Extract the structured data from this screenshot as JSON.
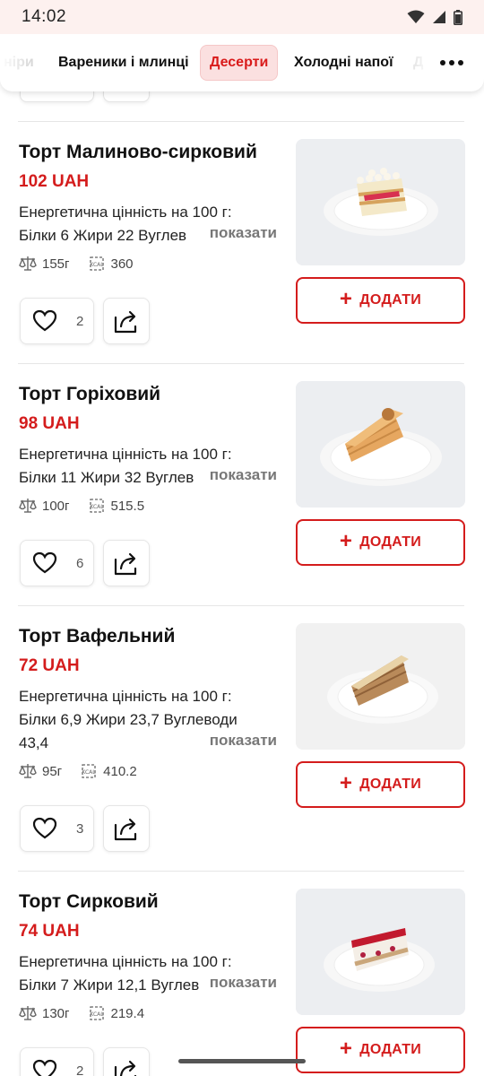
{
  "status_bar": {
    "time": "14:02"
  },
  "tabs": [
    {
      "label": "ніри",
      "state": "faded"
    },
    {
      "label": "Вареники і млинці",
      "state": "normal"
    },
    {
      "label": "Десерти",
      "state": "active"
    },
    {
      "label": "Холодні напої",
      "state": "normal"
    },
    {
      "label": "Д",
      "state": "faded"
    }
  ],
  "products": [
    {
      "name": "Торт Малиново-сирковий",
      "price": "102 UAH",
      "nutrition_line1": "Енергетична цінність на 100 г:",
      "nutrition_line2": "Білки 6 Жири 22 Вуглев",
      "nutrition_line3": "",
      "show_more": "показати",
      "weight": "155г",
      "kcal": "360",
      "likes": "2",
      "add_label": "ДОДАТИ"
    },
    {
      "name": "Торт Горіховий",
      "price": "98 UAH",
      "nutrition_line1": "Енергетична цінність на 100 г:",
      "nutrition_line2": "Білки 11 Жири 32 Вуглев",
      "nutrition_line3": "",
      "show_more": "показати",
      "weight": "100г",
      "kcal": "515.5",
      "likes": "6",
      "add_label": "ДОДАТИ"
    },
    {
      "name": "Торт Вафельний",
      "price": "72 UAH",
      "nutrition_line1": "Енергетична цінність на 100 г:",
      "nutrition_line2": "Білки 6,9 Жири 23,7 Вуглеводи",
      "nutrition_line3": "43,4",
      "show_more": "показати",
      "weight": "95г",
      "kcal": "410.2",
      "likes": "3",
      "add_label": "ДОДАТИ"
    },
    {
      "name": "Торт Сирковий",
      "price": "74 UAH",
      "nutrition_line1": "Енергетична цінність на 100 г:",
      "nutrition_line2": "Білки 7 Жири 12,1 Вуглев",
      "nutrition_line3": "",
      "show_more": "показати",
      "weight": "130г",
      "kcal": "219.4",
      "likes": "2",
      "add_label": "ДОДАТИ"
    }
  ],
  "icons": {
    "weight": "scale-icon",
    "kcal": "kcal-icon",
    "like": "heart-icon",
    "share": "share-icon",
    "more": "more-dots-icon"
  },
  "colors": {
    "accent": "#d41c1c",
    "active_tab_bg": "#fbe0e0",
    "status_bar_bg": "#fdf1ef"
  }
}
